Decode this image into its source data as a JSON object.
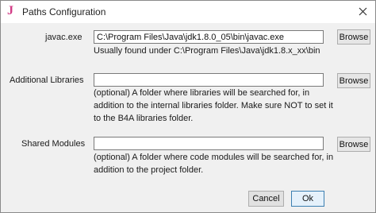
{
  "window": {
    "icon_glyph": "J",
    "title": "Paths Configuration",
    "close_icon": "close-icon"
  },
  "javac": {
    "label": "javac.exe",
    "value": "C:\\Program Files\\Java\\jdk1.8.0_05\\bin\\javac.exe",
    "hint": "Usually found under C:\\Program Files\\Java\\jdk1.8.x_xx\\bin",
    "browse_label": "Browse"
  },
  "additional_libraries": {
    "label": "Additional Libraries",
    "value": "",
    "hint": "(optional) A folder where libraries will be searched for, in addition to the internal libraries folder. Make sure NOT to set it to the B4A libraries folder.",
    "browse_label": "Browse"
  },
  "shared_modules": {
    "label": "Shared Modules",
    "value": "",
    "hint": "(optional) A folder where code modules will be searched for, in addition to the project folder.",
    "browse_label": "Browse"
  },
  "footer": {
    "cancel_label": "Cancel",
    "ok_label": "Ok"
  },
  "colors": {
    "app_icon": "#d23c86",
    "default_button_border": "#3c7fb1"
  }
}
